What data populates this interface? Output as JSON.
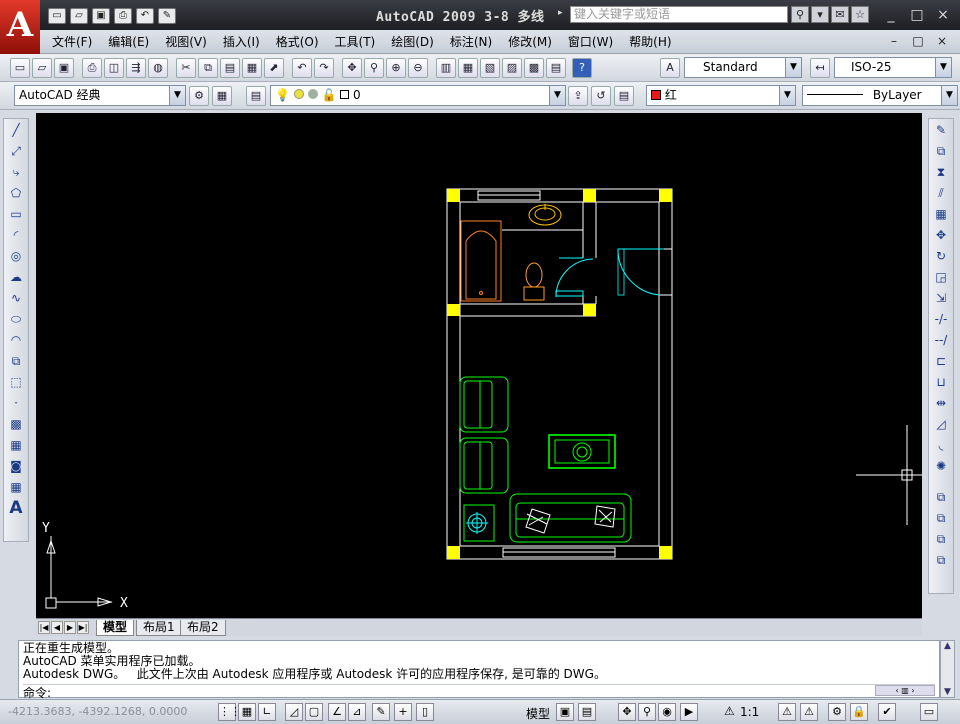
{
  "app": {
    "logo_letter": "A",
    "title": "AutoCAD 2009 3-8 多线",
    "search_placeholder": "键入关键字或短语",
    "window_controls": [
      "_",
      "□",
      "×"
    ],
    "doc_controls": [
      "–",
      "□",
      "×"
    ]
  },
  "quick_access": [
    "new",
    "open",
    "save",
    "print",
    "undo",
    "properties"
  ],
  "menus": [
    "文件(F)",
    "编辑(E)",
    "视图(V)",
    "插入(I)",
    "格式(O)",
    "工具(T)",
    "绘图(D)",
    "标注(N)",
    "修改(M)",
    "窗口(W)",
    "帮助(H)"
  ],
  "toolbar1": {
    "text_style": "Standard",
    "dim_style": "ISO-25"
  },
  "toolbar2": {
    "workspace": "AutoCAD 经典",
    "layer": "0",
    "color": "红",
    "color_swatch": "#e8191b",
    "linetype": "ByLayer"
  },
  "ucs": {
    "x_label": "X",
    "y_label": "Y"
  },
  "layout_tabs": [
    "模型",
    "布局1",
    "布局2"
  ],
  "command_lines": [
    "正在重生成模型。",
    "AutoCAD 菜单实用程序已加载。",
    "Autodesk DWG。   此文件上次由 Autodesk 应用程序或 Autodesk 许可的应用程序保存, 是可靠的 DWG。"
  ],
  "command_prompt": "命令:",
  "status": {
    "coords": "-4213.3683, -4392.1268, 0.0000",
    "model_label": "模型",
    "scale": "1:1"
  },
  "colors": {
    "canvas": "#000000",
    "walls": "#ffffff",
    "columns": "#ffff00",
    "furniture": "#00ff00",
    "doors": "#00ffff",
    "bathtub": "#ff7f27"
  }
}
